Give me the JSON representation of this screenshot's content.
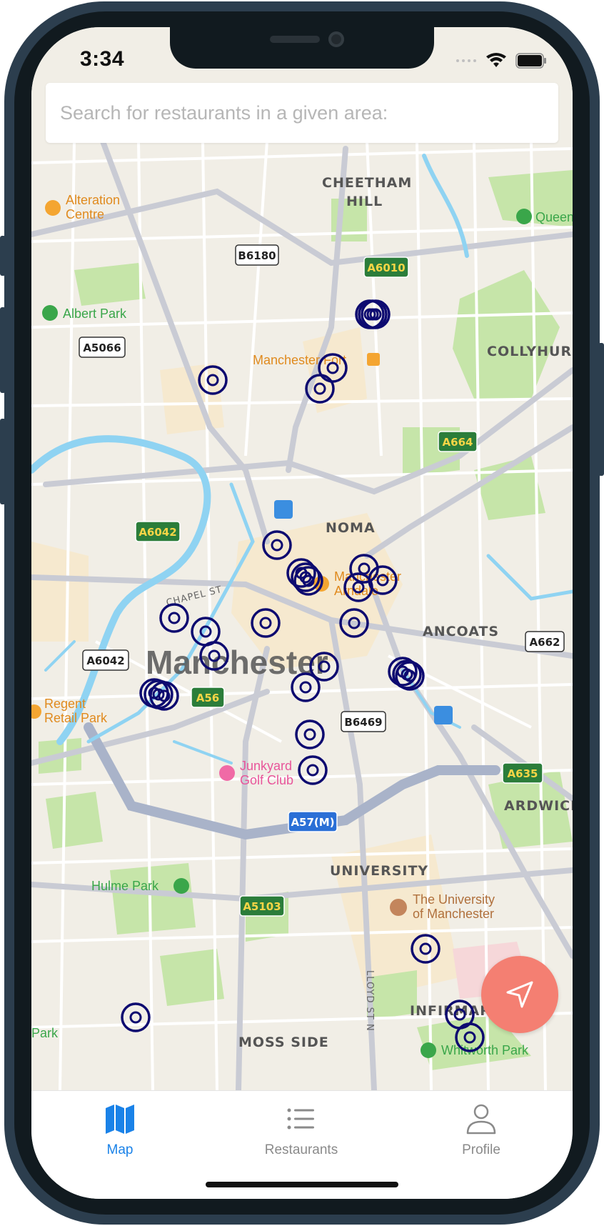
{
  "status_bar": {
    "time": "3:34"
  },
  "search": {
    "placeholder": "Search for restaurants in a given area:"
  },
  "map": {
    "city_label": "Manchester",
    "districts": [
      "CHEETHAM",
      "HILL",
      "COLLYHURST",
      "NOMA",
      "ANCOATS",
      "ARDWICK",
      "UNIVERSITY",
      "INFIRMARY",
      "MOSS SIDE"
    ],
    "street_labels": [
      "CHAPEL ST",
      "LLOYD ST N"
    ],
    "road_badges": [
      "B6180",
      "A6010",
      "A5066",
      "A664",
      "A6042",
      "A6042",
      "A662",
      "A56",
      "B6469",
      "A635",
      "A57(M)",
      "A5103"
    ],
    "places": [
      "Alteration",
      "Centre",
      "Queen",
      "Albert Park",
      "Manchester Fort",
      "Manchester",
      "Arndale",
      "Regent",
      "Retail Park",
      "Junkyard",
      "Golf Club",
      "Hulme Park",
      "The University",
      "of Manchester",
      "Whitworth Park",
      "Park"
    ],
    "marker_color": "#0d0a70",
    "water_color": "#8fd3f2",
    "park_color": "#c6e5a9"
  },
  "fab": {
    "icon": "navigation-arrow-icon",
    "color": "#f47f72"
  },
  "tabs": [
    {
      "label": "Map",
      "icon": "map-icon",
      "active": true
    },
    {
      "label": "Restaurants",
      "icon": "list-icon",
      "active": false
    },
    {
      "label": "Profile",
      "icon": "person-icon",
      "active": false
    }
  ],
  "accent_color": "#1a82e8"
}
